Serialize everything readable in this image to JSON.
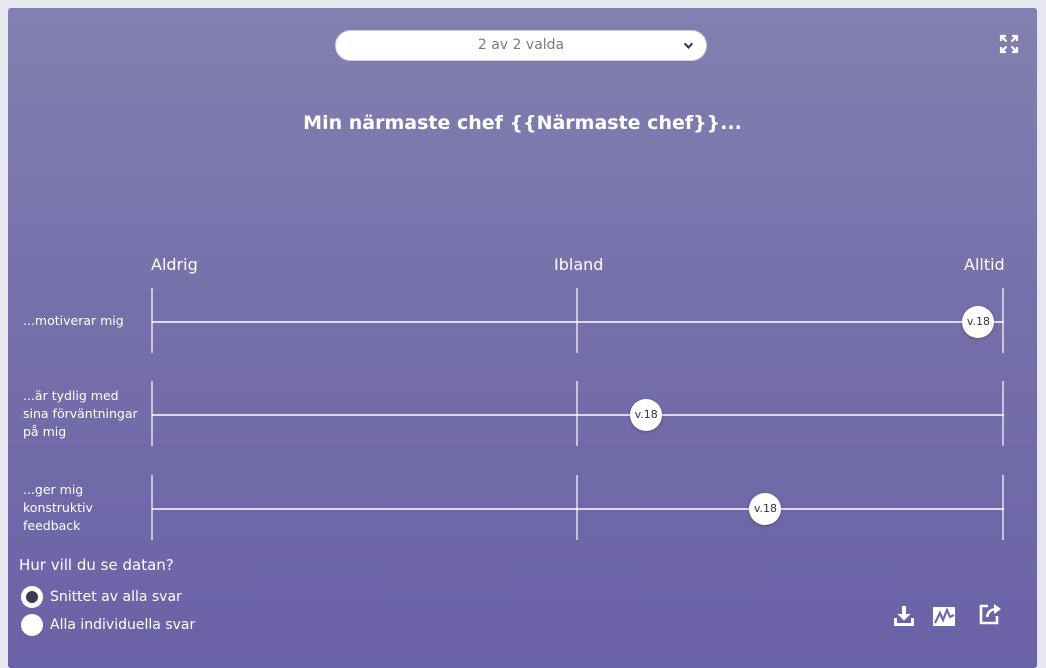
{
  "selector": {
    "value": "2 av 2 valda"
  },
  "title": "Min närmaste chef {{Närmaste chef}}...",
  "scale": {
    "left": "Aldrig",
    "middle": "Ibland",
    "right": "Alltid"
  },
  "rows": [
    {
      "label": "...motiverar mig",
      "marker": "v.18",
      "position": 0.97
    },
    {
      "label": "...är tydlig med sina förväntningar på mig",
      "marker": "v.18",
      "position": 0.58
    },
    {
      "label": "...ger mig konstruktiv feedback",
      "marker": "v.18",
      "position": 0.72
    }
  ],
  "view": {
    "question": "Hur vill du se datan?",
    "options": [
      {
        "label": "Snittet av alla svar",
        "selected": true
      },
      {
        "label": "Alla individuella svar",
        "selected": false
      }
    ]
  },
  "toolbar": {
    "icons": [
      "download-icon",
      "chart-icon",
      "share-icon"
    ]
  },
  "colors": {
    "background_top": "#8280b0",
    "background_bottom": "#6a62a6",
    "text": "#ffffff"
  }
}
